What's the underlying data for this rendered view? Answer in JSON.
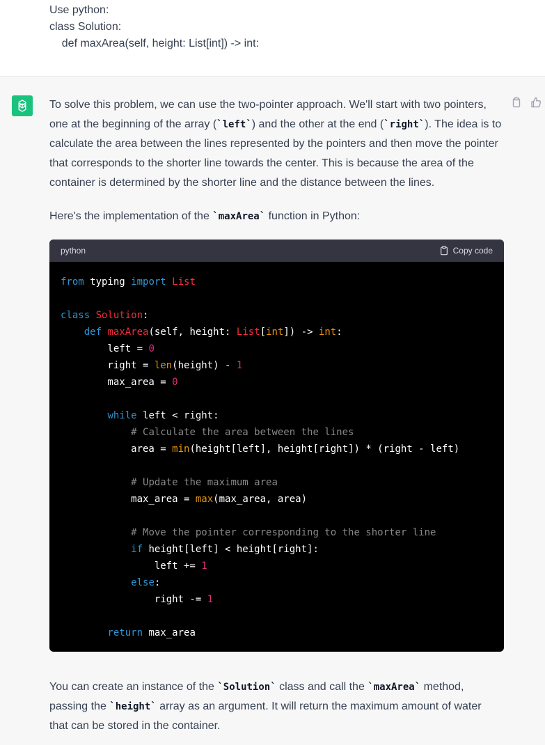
{
  "user_message": {
    "lines": [
      "Use python:",
      "class Solution:",
      "    def maxArea(self, height: List[int]) -> int:"
    ]
  },
  "assistant": {
    "avatar_icon": "openai-logo-icon",
    "avatar_color": "#19c37d",
    "actions": [
      "copy-icon",
      "thumbs-up-icon"
    ],
    "intro": {
      "t1": "To solve this problem, we can use the two-pointer approach. We'll start with two pointers, one at the beginning of the array (",
      "c1": "`left`",
      "t2": ") and the other at the end (",
      "c2": "`right`",
      "t3": "). The idea is to calculate the area between the lines represented by the pointers and then move the pointer that corresponds to the shorter line towards the center. This is because the area of the container is determined by the shorter line and the distance between the lines."
    },
    "impl": {
      "t1": "Here's the implementation of the ",
      "c1": "`maxArea`",
      "t2": " function in Python:"
    },
    "code_block": {
      "language": "python",
      "copy_label": "Copy code",
      "lines": [
        [
          [
            "kw",
            "from"
          ],
          [
            "p",
            " typing "
          ],
          [
            "kw",
            "import"
          ],
          [
            "p",
            " "
          ],
          [
            "cls",
            "List"
          ]
        ],
        [],
        [
          [
            "kw",
            "class"
          ],
          [
            "p",
            " "
          ],
          [
            "cls",
            "Solution"
          ],
          [
            "p",
            ":"
          ]
        ],
        [
          [
            "p",
            "    "
          ],
          [
            "kw",
            "def"
          ],
          [
            "p",
            " "
          ],
          [
            "cls",
            "maxArea"
          ],
          [
            "p",
            "(self, height: "
          ],
          [
            "cls",
            "List"
          ],
          [
            "p",
            "["
          ],
          [
            "bi",
            "int"
          ],
          [
            "p",
            "]) -> "
          ],
          [
            "bi",
            "int"
          ],
          [
            "p",
            ":"
          ]
        ],
        [
          [
            "p",
            "        left = "
          ],
          [
            "num",
            "0"
          ]
        ],
        [
          [
            "p",
            "        right = "
          ],
          [
            "bi",
            "len"
          ],
          [
            "p",
            "(height) - "
          ],
          [
            "num",
            "1"
          ]
        ],
        [
          [
            "p",
            "        max_area = "
          ],
          [
            "num",
            "0"
          ]
        ],
        [],
        [
          [
            "p",
            "        "
          ],
          [
            "kw",
            "while"
          ],
          [
            "p",
            " left < right:"
          ]
        ],
        [
          [
            "p",
            "            "
          ],
          [
            "cm",
            "# Calculate the area between the lines"
          ]
        ],
        [
          [
            "p",
            "            area = "
          ],
          [
            "bi",
            "min"
          ],
          [
            "p",
            "(height[left], height[right]) * (right - left)"
          ]
        ],
        [],
        [
          [
            "p",
            "            "
          ],
          [
            "cm",
            "# Update the maximum area"
          ]
        ],
        [
          [
            "p",
            "            max_area = "
          ],
          [
            "bi",
            "max"
          ],
          [
            "p",
            "(max_area, area)"
          ]
        ],
        [],
        [
          [
            "p",
            "            "
          ],
          [
            "cm",
            "# Move the pointer corresponding to the shorter line"
          ]
        ],
        [
          [
            "p",
            "            "
          ],
          [
            "kw",
            "if"
          ],
          [
            "p",
            " height[left] < height[right]:"
          ]
        ],
        [
          [
            "p",
            "                left += "
          ],
          [
            "num",
            "1"
          ]
        ],
        [
          [
            "p",
            "            "
          ],
          [
            "kw",
            "else"
          ],
          [
            "p",
            ":"
          ]
        ],
        [
          [
            "p",
            "                right -= "
          ],
          [
            "num",
            "1"
          ]
        ],
        [],
        [
          [
            "p",
            "        "
          ],
          [
            "kw",
            "return"
          ],
          [
            "p",
            " max_area"
          ]
        ]
      ]
    },
    "outro": {
      "t1": "You can create an instance of the ",
      "c1": "`Solution`",
      "t2": " class and call the ",
      "c2": "`maxArea`",
      "t3": " method, passing the ",
      "c3": "`height`",
      "t4": " array as an argument. It will return the maximum amount of water that can be stored in the container."
    }
  },
  "colors": {
    "keyword": "#2e95d3",
    "class_name": "#f22c3d",
    "number": "#df3079",
    "builtin": "#e9950c",
    "comment": "#888888",
    "code_bg": "#000000",
    "code_header_bg": "#343541"
  }
}
